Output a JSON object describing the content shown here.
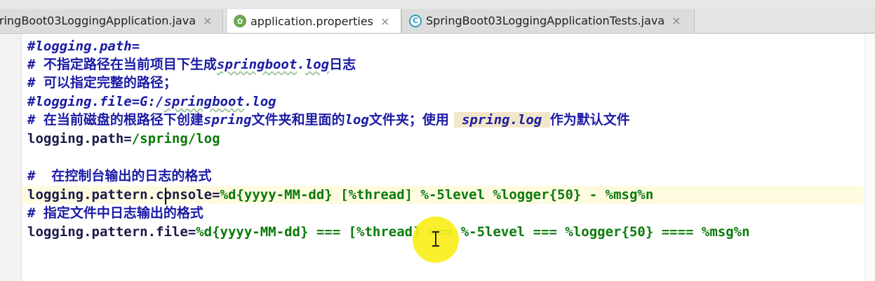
{
  "tabs": [
    {
      "label": "ringBoot03LoggingApplication.java",
      "icon": "java-class-icon",
      "active": false
    },
    {
      "label": "application.properties",
      "icon": "spring-leaf-icon",
      "active": true
    },
    {
      "label": "SpringBoot03LoggingApplicationTests.java",
      "icon": "test-class-icon",
      "active": false
    }
  ],
  "close_glyph": "×",
  "editor": {
    "lines": [
      {
        "parts": [
          {
            "cls": "comment",
            "text": "#logging.path="
          }
        ]
      },
      {
        "parts": [
          {
            "cls": "comment",
            "text": "# "
          },
          {
            "cls": "comment cjk",
            "text": "不指定路径在当前项目下生成"
          },
          {
            "cls": "comment wavy",
            "text": "springboot"
          },
          {
            "cls": "comment",
            "text": "."
          },
          {
            "cls": "comment wavy",
            "text": "log"
          },
          {
            "cls": "comment cjk",
            "text": "日志"
          }
        ]
      },
      {
        "parts": [
          {
            "cls": "comment",
            "text": "# "
          },
          {
            "cls": "comment cjk",
            "text": "可以指定完整的路径；"
          }
        ]
      },
      {
        "parts": [
          {
            "cls": "comment",
            "text": "#logging.file=G:/"
          },
          {
            "cls": "comment wavy",
            "text": "springboot"
          },
          {
            "cls": "comment",
            "text": ".log"
          }
        ]
      },
      {
        "parts": [
          {
            "cls": "comment",
            "text": "# "
          },
          {
            "cls": "comment cjk",
            "text": "在当前磁盘的根路径下创建"
          },
          {
            "cls": "comment",
            "text": "spring"
          },
          {
            "cls": "comment cjk",
            "text": "文件夹和里面的"
          },
          {
            "cls": "comment",
            "text": "log"
          },
          {
            "cls": "comment cjk",
            "text": "文件夹；使用 "
          },
          {
            "cls": "comment hl",
            "text": " spring.log "
          },
          {
            "cls": "comment cjk",
            "text": "作为默认文件"
          }
        ]
      },
      {
        "parts": [
          {
            "cls": "key",
            "text": "logging.path"
          },
          {
            "cls": "eq",
            "text": "="
          },
          {
            "cls": "val",
            "text": "/spring/log"
          }
        ]
      },
      {
        "parts": []
      },
      {
        "parts": [
          {
            "cls": "comment",
            "text": "#  "
          },
          {
            "cls": "comment cjk",
            "text": "在控制台输出的日志的格式"
          }
        ]
      },
      {
        "parts": [
          {
            "cls": "key",
            "text": "logging.pattern.console"
          },
          {
            "cls": "eq",
            "text": "="
          },
          {
            "cls": "val",
            "text": "%d{yyyy-MM-dd} [%thread] %-5level %logger{50} - %msg%n"
          }
        ],
        "caret": true
      },
      {
        "parts": [
          {
            "cls": "comment",
            "text": "# "
          },
          {
            "cls": "comment cjk",
            "text": "指定文件中日志输出的格式"
          }
        ]
      },
      {
        "parts": [
          {
            "cls": "key",
            "text": "logging.pattern.file"
          },
          {
            "cls": "eq",
            "text": "="
          },
          {
            "cls": "val",
            "text": "%d{yyyy-MM-dd} === [%thread] === %-5level === %logger{50} ==== %msg%n"
          }
        ]
      }
    ]
  },
  "colors": {
    "comment": "#1b1ba5",
    "key": "#1a1a4a",
    "value": "#0a7a0a",
    "cursor_highlight": "#f8ee1a"
  }
}
